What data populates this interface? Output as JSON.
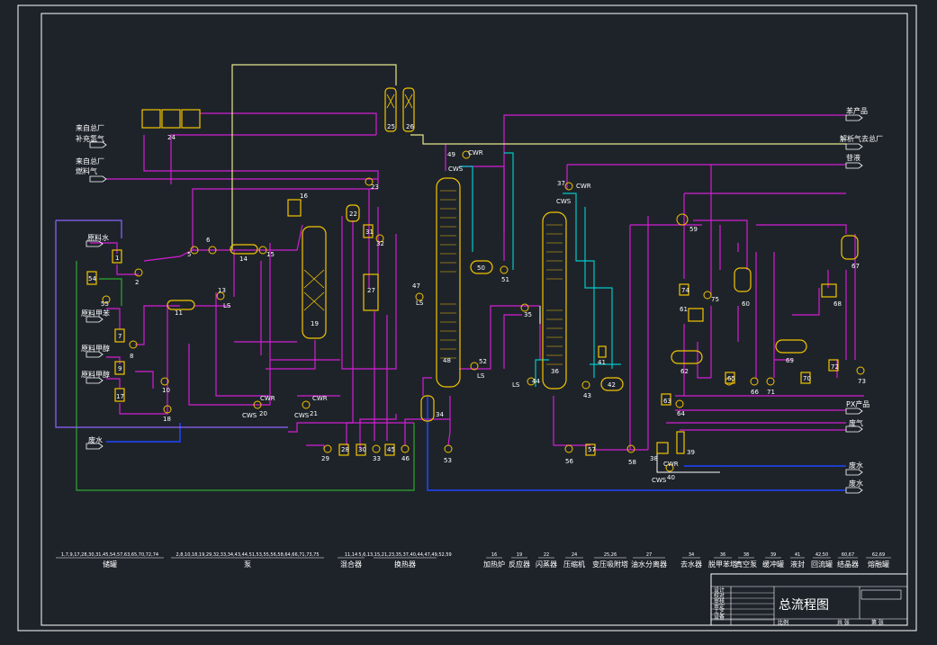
{
  "drawing": {
    "title": "总流程图"
  },
  "colors": {
    "background": "#1e232a",
    "frame": "#ffffff",
    "equipment": "#f2c400",
    "process": "#d21ed2",
    "hydrogen": "#e6e68c",
    "cooling_water": "#00c8c8",
    "waste_water": "#1e46ff",
    "green_line": "#2ea82e",
    "violet_line": "#8c64ff",
    "steam": "#ffffff"
  },
  "stream_labels": {
    "from_plant": "来自总厂",
    "makeup_hydrogen": "补充氢气",
    "fuel_gas": "燃料气",
    "raw_water": "原料水",
    "raw_benzene": "原料甲苯",
    "raw_methanol_1": "原料甲醇",
    "raw_methanol_2": "原料甲醇",
    "waste_water_left": "废水",
    "benzene_product": "苯产品",
    "desorbed_gas": "解析气去总厂",
    "heavy_liquid": "苷液",
    "px_product": "PX产品",
    "waste_gas": "废气",
    "waste_water_1": "废水",
    "waste_water_2": "废水"
  },
  "utility_tags": {
    "cwr": "CWR",
    "cws": "CWS",
    "ls": "LS"
  },
  "equipment_numbers": [
    "1",
    "2",
    "5",
    "6",
    "7",
    "8",
    "9",
    "10",
    "11",
    "13",
    "14",
    "15",
    "16",
    "17",
    "18",
    "19",
    "20",
    "21",
    "22",
    "23",
    "24",
    "25",
    "26",
    "27",
    "28",
    "29",
    "30",
    "31",
    "32",
    "33",
    "34",
    "35",
    "36",
    "37",
    "38",
    "39",
    "40",
    "41",
    "42",
    "43",
    "44",
    "45",
    "46",
    "47",
    "48",
    "49",
    "50",
    "51",
    "52",
    "53",
    "54",
    "55",
    "56",
    "57",
    "58",
    "59",
    "60",
    "61",
    "62",
    "63",
    "64",
    "65",
    "66",
    "67",
    "68",
    "69",
    "70",
    "71",
    "72",
    "73",
    "74",
    "75"
  ],
  "legend": [
    {
      "tags": "1,7,9,17,28,30,31,45,54,57,63,65,70,72,74",
      "name": "储罐"
    },
    {
      "tags": "2,8,10,18,19,29,32,33,34,43,44,51,53,55,56,58,64,66,71,73,75",
      "name": "泵"
    },
    {
      "tags": "11,14",
      "name": "混合器"
    },
    {
      "tags": "5,6,13,15,21,23,35,37,40,44,47,49,52,59",
      "name": "换热器"
    },
    {
      "tags": "16",
      "name": "加热炉"
    },
    {
      "tags": "19",
      "name": "反应器"
    },
    {
      "tags": "22",
      "name": "闪蒸器"
    },
    {
      "tags": "24",
      "name": "压缩机"
    },
    {
      "tags": "25,26",
      "name": "变压吸附塔"
    },
    {
      "tags": "27",
      "name": "油水分离器"
    },
    {
      "tags": "34",
      "name": "去水器"
    },
    {
      "tags": "36",
      "name": "脱甲苯塔"
    },
    {
      "tags": "38",
      "name": "真空泵"
    },
    {
      "tags": "39",
      "name": "缓冲罐"
    },
    {
      "tags": "41",
      "name": "液封"
    },
    {
      "tags": "42,50",
      "name": "回流罐"
    },
    {
      "tags": "60,67",
      "name": "结晶器"
    },
    {
      "tags": "62,69",
      "name": "熔融罐"
    }
  ],
  "title_block": {
    "rows": [
      "设计",
      "校对",
      "审核",
      "审定",
      "工艺",
      "设备"
    ],
    "scale": "比例",
    "total": "共 张",
    "sheet": "第 张"
  }
}
